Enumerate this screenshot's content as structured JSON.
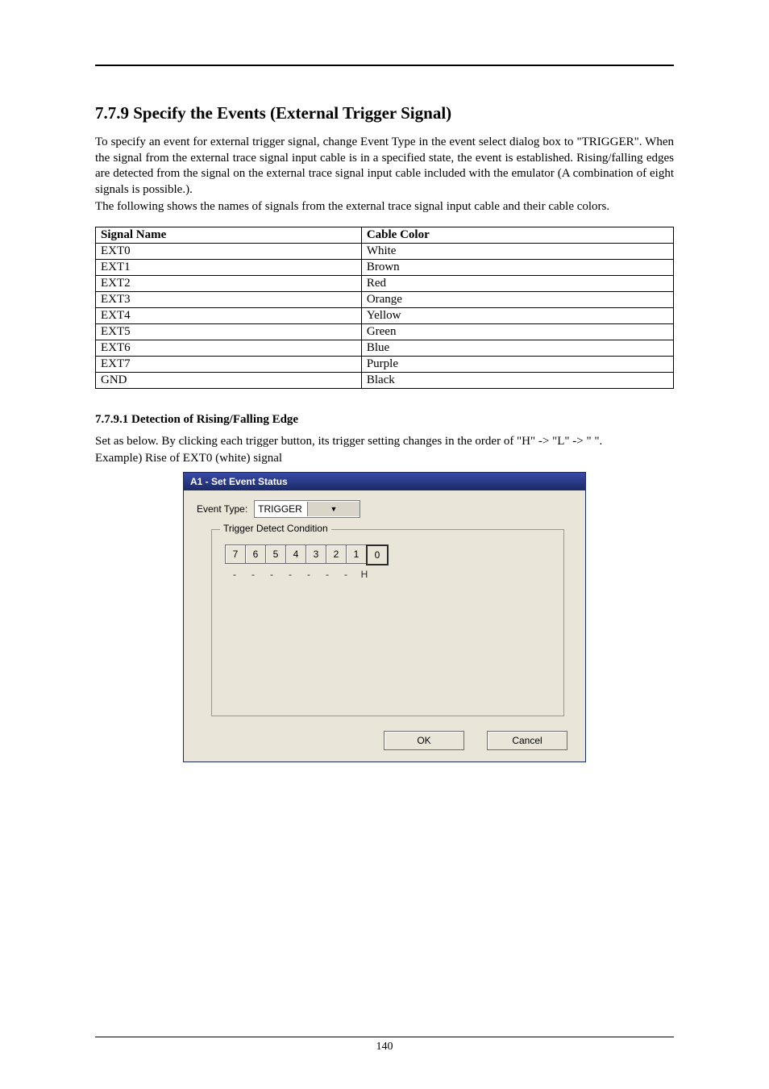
{
  "section_title": "7.7.9 Specify the Events (External Trigger Signal)",
  "para1": "To specify an event for external trigger signal, change Event Type in the event select dialog box to \"TRIGGER\". When the signal from the external trace signal input cable is in a specified state, the event is established. Rising/falling edges are detected from the signal on the external trace signal input cable included with the emulator (A combination of eight signals is possible.).",
  "para2": "The following shows the names of signals from the external trace signal input cable and their cable colors.",
  "table": {
    "headers": [
      "Signal Name",
      "Cable Color"
    ],
    "rows": [
      [
        "EXT0",
        "White"
      ],
      [
        "EXT1",
        "Brown"
      ],
      [
        "EXT2",
        "Red"
      ],
      [
        "EXT3",
        "Orange"
      ],
      [
        "EXT4",
        "Yellow"
      ],
      [
        "EXT5",
        "Green"
      ],
      [
        "EXT6",
        "Blue"
      ],
      [
        "EXT7",
        "Purple"
      ],
      [
        "GND",
        "Black"
      ]
    ]
  },
  "subsection_title": "7.7.9.1 Detection of Rising/Falling Edge",
  "instr1": "Set as below. By clicking each trigger button, its trigger setting changes in the order of \"H\" -> \"L\" -> \" \".",
  "instr2": "Example) Rise of EXT0 (white) signal",
  "dialog": {
    "title": "A1 - Set Event Status",
    "event_type_label": "Event Type:",
    "event_type_value": "TRIGGER",
    "group_legend": "Trigger Detect Condition",
    "buttons": [
      "7",
      "6",
      "5",
      "4",
      "3",
      "2",
      "1",
      "0"
    ],
    "indicators": [
      "-",
      "-",
      "-",
      "-",
      "-",
      "-",
      "-",
      "H"
    ],
    "active_index": 7,
    "ok": "OK",
    "cancel": "Cancel"
  },
  "page_number": "140"
}
